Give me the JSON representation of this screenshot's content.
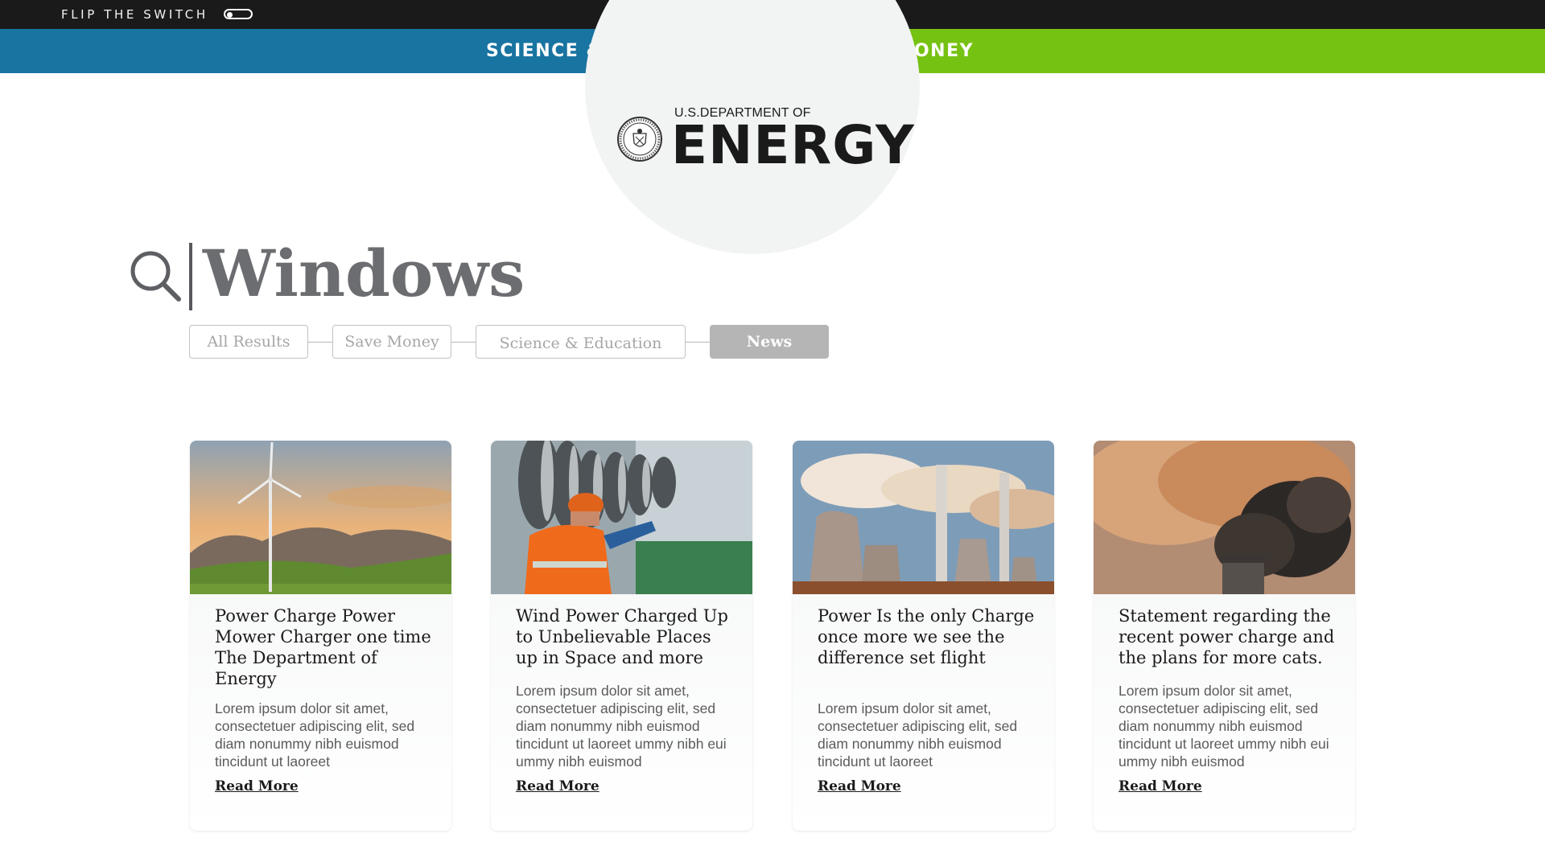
{
  "topbar": {
    "flip_label": "FLIP THE SWITCH"
  },
  "nav": {
    "science_education": "SCIENCE & EDUCATION",
    "save_money": "SAVE MONEY",
    "colors": {
      "science": "#1874a1",
      "save": "#76c212"
    }
  },
  "logo": {
    "small_text": "U.S.DEPARTMENT OF",
    "big_text": "ENERGY"
  },
  "search": {
    "query": "Windows"
  },
  "filters": [
    {
      "label": "All Results",
      "active": false
    },
    {
      "label": "Save Money",
      "active": false
    },
    {
      "label": "Science & Education",
      "active": false
    },
    {
      "label": "News",
      "active": true
    }
  ],
  "cards": [
    {
      "title": "Power Charge Power Mower Charger one time The Department of Energy",
      "description": "Lorem ipsum dolor sit amet, consectetuer adipiscing elit, sed diam nonummy nibh euismod tincidunt ut laoreet",
      "link": "Read More",
      "image": "wind-turbine-image"
    },
    {
      "title": "Wind Power Charged Up to Unbelievable Places up in Space and more",
      "description": "Lorem ipsum dolor sit amet, consectetuer adipiscing elit, sed diam nonummy nibh euismod tincidunt ut laoreet ummy nibh eui ummy nibh euismod",
      "link": "Read More",
      "image": "turbine-worker-image"
    },
    {
      "title": "Power Is the only Charge once more we see the difference set flight",
      "description": "Lorem ipsum dolor sit amet, consectetuer adipiscing elit, sed diam nonummy nibh euismod tincidunt ut laoreet",
      "link": "Read More",
      "image": "power-plant-image"
    },
    {
      "title": "Statement regarding the recent power charge and the plans for more cats.",
      "description": "Lorem ipsum dolor sit amet, consectetuer adipiscing elit, sed diam nonummy nibh euismod tincidunt ut laoreet ummy nibh eui ummy nibh euismod",
      "link": "Read More",
      "image": "smokestack-image"
    }
  ]
}
